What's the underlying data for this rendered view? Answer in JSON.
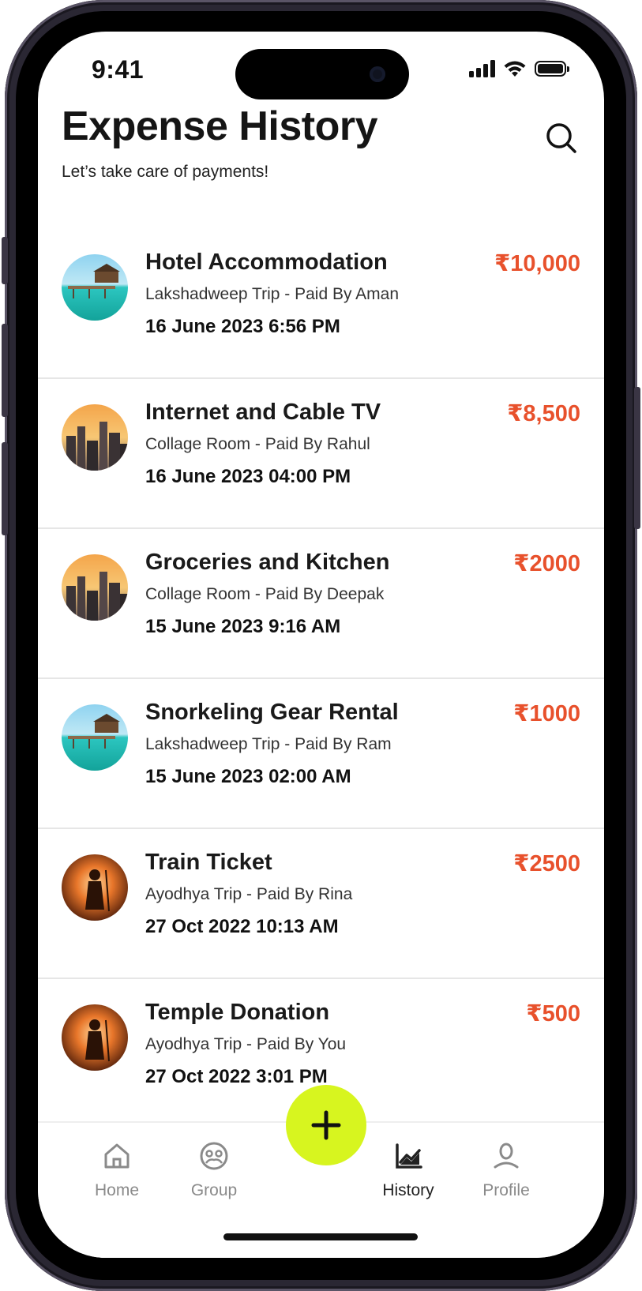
{
  "status_bar": {
    "time": "9:41"
  },
  "header": {
    "title": "Expense History",
    "subtitle": "Let’s take care of payments!",
    "search_icon": "search-icon"
  },
  "colors": {
    "accent_amount": "#e8512c",
    "fab": "#d7f51f"
  },
  "expenses": [
    {
      "title": "Hotel Accommodation",
      "subtitle": "Lakshadweep Trip - Paid By Aman",
      "date": "16 June 2023 6:56 PM",
      "amount": "₹10,000",
      "thumbnail": "beach-resort-image"
    },
    {
      "title": "Internet and Cable TV",
      "subtitle": "Collage Room - Paid By Rahul",
      "date": "16 June 2023 04:00 PM",
      "amount": "₹8,500",
      "thumbnail": "city-skyline-image"
    },
    {
      "title": "Groceries and Kitchen",
      "subtitle": "Collage Room - Paid By Deepak",
      "date": "15 June 2023 9:16 AM",
      "amount": "₹2000",
      "thumbnail": "city-skyline-image"
    },
    {
      "title": "Snorkeling Gear Rental",
      "subtitle": "Lakshadweep Trip - Paid By Ram",
      "date": "15 June 2023 02:00 AM",
      "amount": "₹1000",
      "thumbnail": "beach-resort-image"
    },
    {
      "title": "Train Ticket",
      "subtitle": "Ayodhya Trip - Paid By Rina",
      "date": "27 Oct 2022 10:13 AM",
      "amount": "₹2500",
      "thumbnail": "deity-figure-image"
    },
    {
      "title": "Temple Donation",
      "subtitle": "Ayodhya Trip - Paid By You",
      "date": "27 Oct 2022 3:01 PM",
      "amount": "₹500",
      "thumbnail": "deity-figure-image"
    }
  ],
  "nav": {
    "home": "Home",
    "group": "Group",
    "history": "History",
    "profile": "Profile",
    "active": "History",
    "fab_icon": "plus-icon"
  }
}
